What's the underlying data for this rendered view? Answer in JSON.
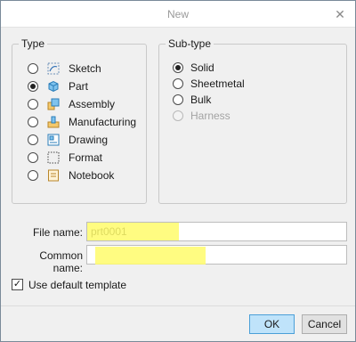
{
  "window": {
    "title": "New",
    "close_glyph": "✕"
  },
  "type_group": {
    "label": "Type",
    "options": [
      {
        "label": "Sketch",
        "selected": false,
        "icon": "sketch-icon"
      },
      {
        "label": "Part",
        "selected": true,
        "icon": "part-icon"
      },
      {
        "label": "Assembly",
        "selected": false,
        "icon": "assembly-icon"
      },
      {
        "label": "Manufacturing",
        "selected": false,
        "icon": "manufacturing-icon"
      },
      {
        "label": "Drawing",
        "selected": false,
        "icon": "drawing-icon"
      },
      {
        "label": "Format",
        "selected": false,
        "icon": "format-icon"
      },
      {
        "label": "Notebook",
        "selected": false,
        "icon": "notebook-icon"
      }
    ]
  },
  "subtype_group": {
    "label": "Sub-type",
    "options": [
      {
        "label": "Solid",
        "selected": true,
        "disabled": false
      },
      {
        "label": "Sheetmetal",
        "selected": false,
        "disabled": false
      },
      {
        "label": "Bulk",
        "selected": false,
        "disabled": false
      },
      {
        "label": "Harness",
        "selected": false,
        "disabled": true
      }
    ]
  },
  "file_name": {
    "label": "File name:",
    "value": "prt0001"
  },
  "common_name": {
    "label": "Common name:",
    "value": ""
  },
  "default_template": {
    "label": "Use default template",
    "checked": true,
    "check_glyph": "✓"
  },
  "buttons": {
    "ok": "OK",
    "cancel": "Cancel"
  },
  "colors": {
    "highlight": "#fffb6b",
    "ok_button": "#bfe3fa",
    "ok_border": "#4a9fd8"
  }
}
